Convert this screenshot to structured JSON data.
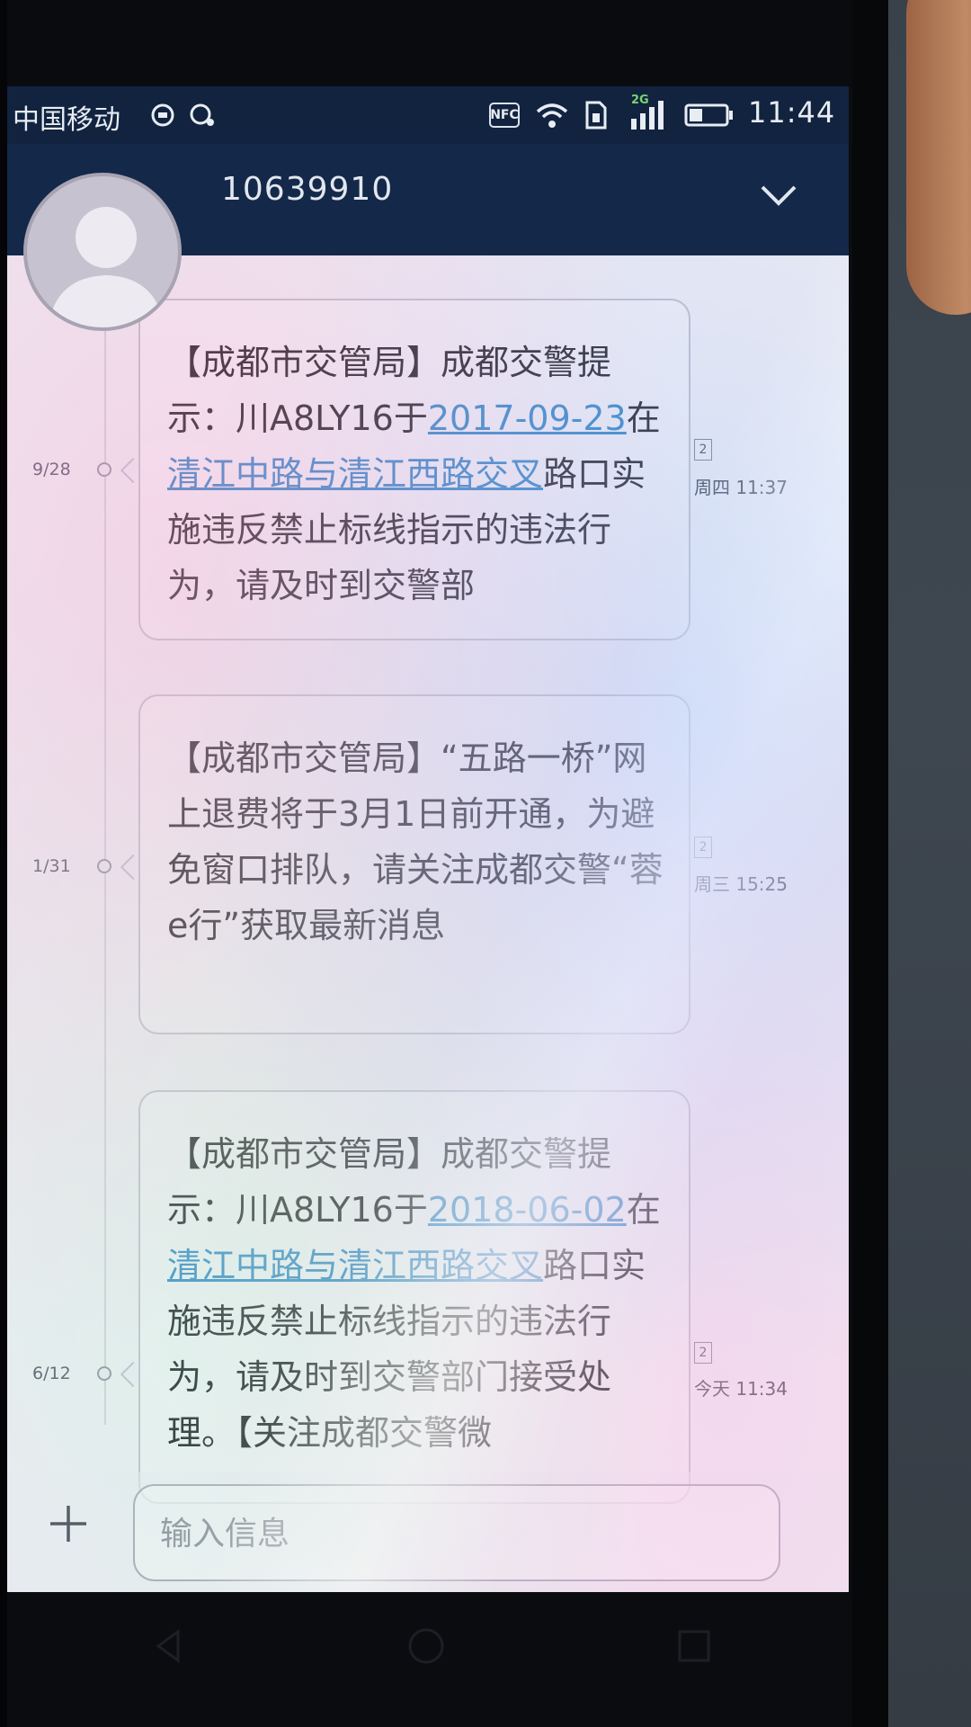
{
  "status_bar": {
    "carrier": "中国移动",
    "network_badge": "2G",
    "nfc_label": "NFC",
    "time": "11:44"
  },
  "header": {
    "contact_number": "10639910"
  },
  "messages": [
    {
      "date_label": "9/28",
      "sim": "2",
      "time": "周四 11:37",
      "text_a": "【成都市交管局】成都交警提示：川A8LY16于",
      "date_link": "2017-09-23",
      "text_b": "在",
      "place_link": "清江中路与清江西路交叉",
      "text_c": "路口实施违反禁止标线指示的违法行为，请及时到交警部"
    },
    {
      "date_label": "1/31",
      "sim": "2",
      "time": "周三 15:25",
      "text": "【成都市交管局】“五路一桥”网上退费将于3月1日前开通，为避免窗口排队，请关注成都交警“蓉e行”获取最新消息"
    },
    {
      "date_label": "6/12",
      "sim": "2",
      "time": "今天 11:34",
      "text_a": "【成都市交管局】成都交警提示：川A8LY16于",
      "date_link": "2018-06-02",
      "text_b": "在",
      "place_link": "清江中路与清江西路交叉",
      "text_c": "路口实施违反禁止标线指示的违法行为，请及时到交警部门接受处理。【关注成都交警微"
    }
  ],
  "composer": {
    "placeholder": "输入信息"
  },
  "icons": {
    "back": "chevron-down-icon",
    "add": "plus-icon"
  },
  "colors": {
    "header_bg": "#14284a",
    "link": "#2e82c4"
  }
}
